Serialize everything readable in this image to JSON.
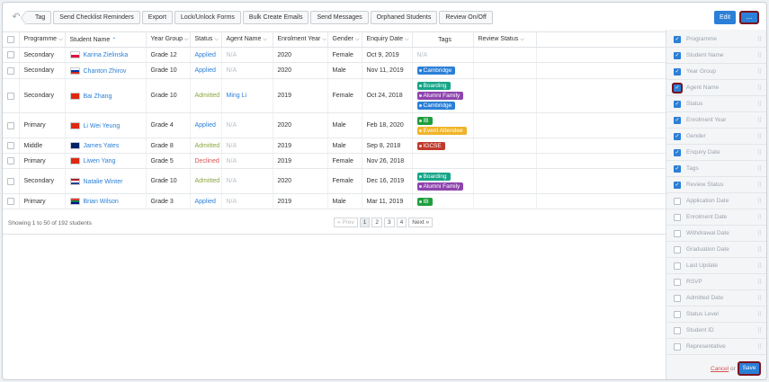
{
  "toolbar": {
    "buttons": [
      "Tag",
      "Send Checklist Reminders",
      "Export",
      "Lock/Unlock Forms",
      "Bulk Create Emails",
      "Send Messages",
      "Orphaned Students",
      "Review On/Off"
    ],
    "edit_label": "Edit",
    "more_label": "..."
  },
  "table": {
    "headers": [
      "Programme",
      "Student Name",
      "Year Group",
      "Status",
      "Agent Name",
      "Enrolment Year",
      "Gender",
      "Enquiry Date",
      "Tags",
      "Review Status"
    ],
    "rows": [
      {
        "programme": "Secondary",
        "name": "Karina Zielinska",
        "flag": "poland",
        "year_group": "Grade 12",
        "status": "Applied",
        "agent": "N/A",
        "enrolment_year": "2020",
        "gender": "Female",
        "enquiry_date": "Oct 9, 2019",
        "tags": [],
        "tags_empty": "N/A"
      },
      {
        "programme": "Secondary",
        "name": "Chanton Zhirov",
        "flag": "russia",
        "year_group": "Grade 10",
        "status": "Applied",
        "agent": "N/A",
        "enrolment_year": "2020",
        "gender": "Male",
        "enquiry_date": "Nov 11, 2019",
        "tags": [
          "Cambridge"
        ]
      },
      {
        "programme": "Secondary",
        "name": "Bai Zhang",
        "flag": "china",
        "year_group": "Grade 10",
        "status": "Admitted",
        "agent": "Ming Li",
        "enrolment_year": "2019",
        "gender": "Female",
        "enquiry_date": "Oct 24, 2018",
        "tags": [
          "Boarding",
          "Alumni Family",
          "Cambridge"
        ]
      },
      {
        "programme": "Primary",
        "name": "Li Wei Yeung",
        "flag": "china",
        "year_group": "Grade 4",
        "status": "Applied",
        "agent": "N/A",
        "enrolment_year": "2020",
        "gender": "Male",
        "enquiry_date": "Feb 18, 2020",
        "tags": [
          "IB",
          "Event Attendee"
        ]
      },
      {
        "programme": "Middle",
        "name": "James Yates",
        "flag": "australia",
        "year_group": "Grade 8",
        "status": "Admitted",
        "agent": "N/A",
        "enrolment_year": "2019",
        "gender": "Male",
        "enquiry_date": "Sep 8, 2018",
        "tags": [
          "IGCSE"
        ]
      },
      {
        "programme": "Primary",
        "name": "Liwen Yang",
        "flag": "china",
        "year_group": "Grade 5",
        "status": "Declined",
        "agent": "N/A",
        "enrolment_year": "2019",
        "gender": "Female",
        "enquiry_date": "Nov 26, 2018",
        "tags": []
      },
      {
        "programme": "Secondary",
        "name": "Natalie Winter",
        "flag": "netherlands",
        "year_group": "Grade 10",
        "status": "Admitted",
        "agent": "N/A",
        "enrolment_year": "2020",
        "gender": "Female",
        "enquiry_date": "Dec 16, 2019",
        "tags": [
          "Boarding",
          "Alumni Family"
        ]
      },
      {
        "programme": "Primary",
        "name": "Brian Wilson",
        "flag": "south-africa",
        "year_group": "Grade 3",
        "status": "Applied",
        "agent": "N/A",
        "enrolment_year": "2019",
        "gender": "Male",
        "enquiry_date": "Mar 11, 2019",
        "tags": [
          "IB"
        ]
      }
    ],
    "tag_colors": {
      "Cambridge": "#2b7fd6",
      "Boarding": "#17a589",
      "Alumni Family": "#8e44ad",
      "IB": "#1e9e3e",
      "Event Attendee": "#f0b429",
      "IGCSE": "#c0392b"
    }
  },
  "footer": {
    "showing": "Showing 1 to 50 of 192 students",
    "pages": [
      "« Prev",
      "1",
      "2",
      "3",
      "4",
      "Next »"
    ]
  },
  "panel": {
    "columns": [
      {
        "label": "Programme",
        "checked": true
      },
      {
        "label": "Student Name",
        "checked": true
      },
      {
        "label": "Year Group",
        "checked": true
      },
      {
        "label": "Agent Name",
        "checked": true,
        "highlighted": true
      },
      {
        "label": "Status",
        "checked": true
      },
      {
        "label": "Enrolment Year",
        "checked": true
      },
      {
        "label": "Gender",
        "checked": true
      },
      {
        "label": "Enquiry Date",
        "checked": true
      },
      {
        "label": "Tags",
        "checked": true
      },
      {
        "label": "Review Status",
        "checked": true
      },
      {
        "label": "Application Date",
        "checked": false
      },
      {
        "label": "Enrolment Date",
        "checked": false
      },
      {
        "label": "Withdrawal Date",
        "checked": false
      },
      {
        "label": "Graduation Date",
        "checked": false
      },
      {
        "label": "Last Update",
        "checked": false
      },
      {
        "label": "RSVP",
        "checked": false
      },
      {
        "label": "Admitted Date",
        "checked": false
      },
      {
        "label": "Status Level",
        "checked": false
      },
      {
        "label": "Student ID",
        "checked": false
      },
      {
        "label": "Representative",
        "checked": false
      }
    ],
    "cancel_label": "Cancel",
    "or_label": "or",
    "save_label": "Save"
  },
  "colors": {
    "accent": "#2b7fd6",
    "highlight_ring": "#7a1420",
    "admitted": "#8aa63b",
    "declined": "#d9534f"
  }
}
